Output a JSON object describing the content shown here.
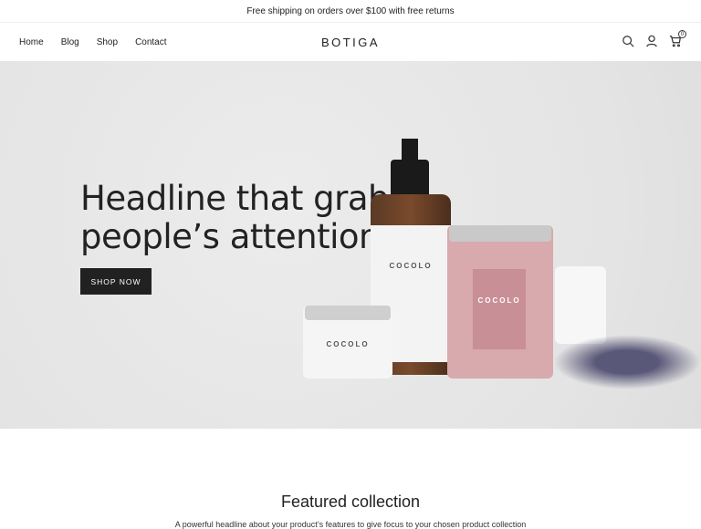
{
  "announcement": "Free shipping on orders over $100 with free returns",
  "nav": {
    "items": [
      {
        "label": "Home"
      },
      {
        "label": "Blog"
      },
      {
        "label": "Shop"
      },
      {
        "label": "Contact"
      }
    ]
  },
  "brand": "BOTIGA",
  "header_icons": [
    "search-icon",
    "user-icon",
    "cart-icon"
  ],
  "cart_count": "0",
  "hero": {
    "headline_line1": "Headline that grabs",
    "headline_line2": "people’s attention",
    "cta": "SHOP NOW",
    "product_label": "COCOLO"
  },
  "featured": {
    "title": "Featured collection",
    "subtitle": "A powerful headline about your product’s features to give focus to your chosen product collection"
  },
  "colors": {
    "button": "#212121",
    "hero_bg": "#e6e6e6",
    "jar_pink": "#d8a9ad"
  }
}
